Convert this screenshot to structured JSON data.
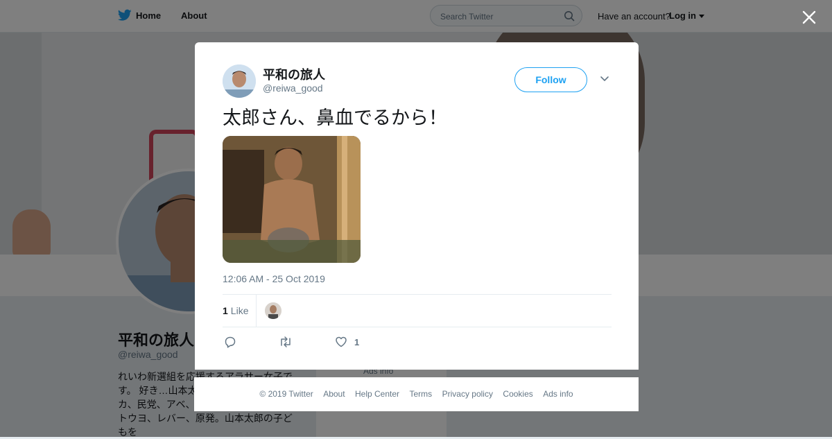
{
  "header": {
    "home_label": "Home",
    "about_label": "About",
    "search_placeholder": "Search Twitter",
    "have_account": "Have an account?",
    "login_label": "Log in"
  },
  "profile": {
    "name": "平和の旅人",
    "handle": "@reiwa_good",
    "bio": "れいわ新選組を応援するアラサー女子です。 好き…山本太郎、方神起、タピオカ、民党、アベ、憲法改悪の人たち、ネトウヨ、レバー、原発。山本太郎の子どもを",
    "ads_card_label": "Ads info"
  },
  "tweet": {
    "author_name": "平和の旅人",
    "author_handle": "@reiwa_good",
    "follow_label": "Follow",
    "text": "太郎さん、鼻血でるから！",
    "timestamp": "12:06 AM - 25 Oct 2019",
    "likes_count": "1",
    "likes_label": "Like",
    "like_action_count": "1"
  },
  "footer": {
    "links": [
      "© 2019 Twitter",
      "About",
      "Help Center",
      "Terms",
      "Privacy policy",
      "Cookies",
      "Ads info"
    ]
  },
  "colors": {
    "accent": "#1da1f2",
    "text_primary": "#14171a",
    "text_secondary": "#657786"
  }
}
